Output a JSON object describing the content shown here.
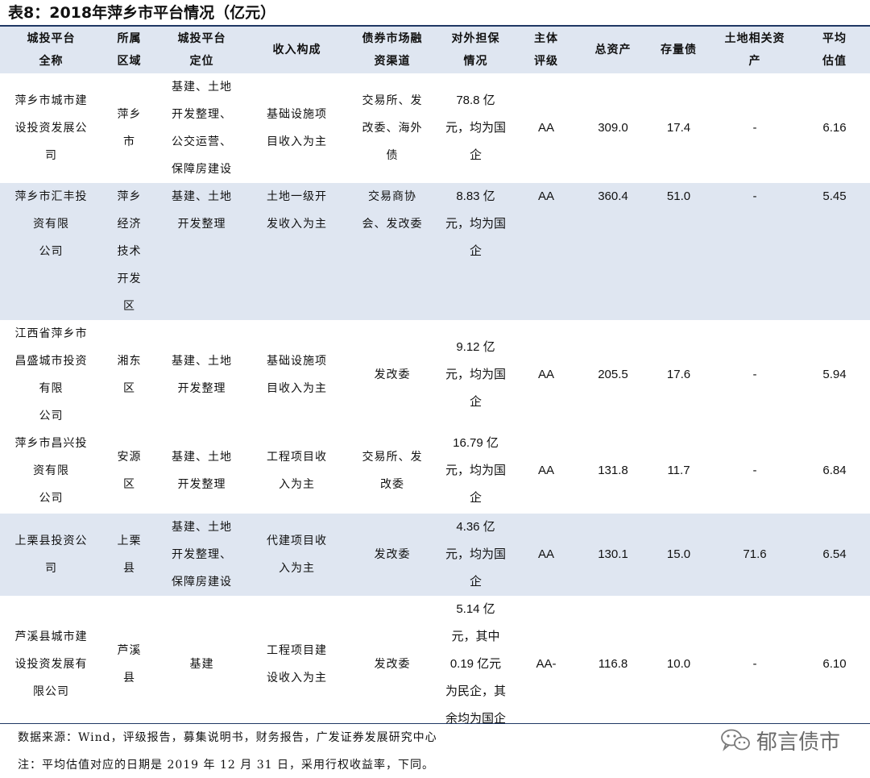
{
  "title": "表8：2018年萍乡市平台情况（亿元）",
  "headers": [
    "城投平台\n全称",
    "所属\n区域",
    "城投平台\n定位",
    "收入构成",
    "债券市场融\n资渠道",
    "对外担保\n情况",
    "主体\n评级",
    "总资产",
    "存量债",
    "土地相关资\n产",
    "平均\n估值"
  ],
  "rows": [
    [
      "萍乡市城市建\n设投资发展公\n司",
      "萍乡\n市",
      "基建、土地\n开发整理、\n公交运营、\n保障房建设",
      "基础设施项\n目收入为主",
      "交易所、发\n改委、海外\n债",
      "78.8 亿\n元，均为国\n企",
      "AA",
      "309.0",
      "17.4",
      "-",
      "6.16"
    ],
    [
      "萍乡市汇丰投\n资有限\n公司",
      "萍乡\n经济\n技术\n开发\n区",
      "基建、土地\n开发整理",
      "土地一级开\n发收入为主",
      "交易商协\n会、发改委",
      "8.83 亿\n元，均为国\n企",
      "AA",
      "360.4",
      "51.0",
      "-",
      "5.45"
    ],
    [
      "江西省萍乡市\n昌盛城市投资\n有限\n公司",
      "湘东\n区",
      "基建、土地\n开发整理",
      "基础设施项\n目收入为主",
      "发改委",
      "9.12 亿\n元，均为国\n企",
      "AA",
      "205.5",
      "17.6",
      "-",
      "5.94"
    ],
    [
      "萍乡市昌兴投\n资有限\n公司",
      "安源\n区",
      "基建、土地\n开发整理",
      "工程项目收\n入为主",
      "交易所、发\n改委",
      "16.79 亿\n元，均为国\n企",
      "AA",
      "131.8",
      "11.7",
      "-",
      "6.84"
    ],
    [
      "上栗县投资公\n司",
      "上栗\n县",
      "基建、土地\n开发整理、\n保障房建设",
      "代建项目收\n入为主",
      "发改委",
      "4.36 亿\n元，均为国\n企",
      "AA",
      "130.1",
      "15.0",
      "71.6",
      "6.54"
    ],
    [
      "芦溪县城市建\n设投资发展有\n限公司",
      "芦溪\n县",
      "基建",
      "工程项目建\n设收入为主",
      "发改委",
      "5.14 亿\n元，其中\n0.19 亿元\n为民企，其\n余均为国企",
      "AA-",
      "116.8",
      "10.0",
      "-",
      "6.10"
    ]
  ],
  "source_note": "数据来源：Wind，评级报告，募集说明书，财务报告，广发证券发展研究中心",
  "footnote": "注：平均估值对应的日期是 2019 年 12 月 31 日，采用行权收益率，下同。",
  "watermark": {
    "icon": "wechat-icon",
    "text": "郁言债市"
  },
  "colors": {
    "header_band": "#dfe6f1",
    "rule": "#1f3864"
  }
}
